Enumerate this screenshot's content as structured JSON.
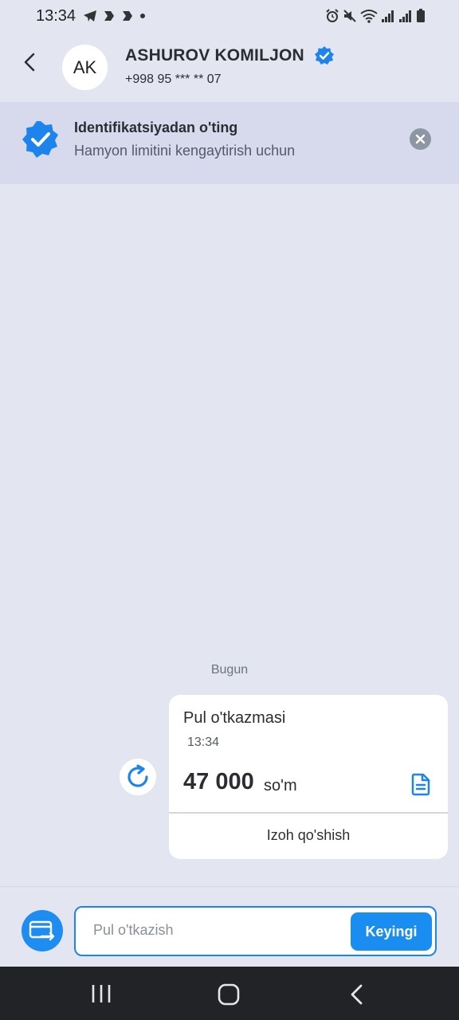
{
  "status_bar": {
    "time": "13:34",
    "left_icons": [
      "telegram-icon",
      "app-icon",
      "app-icon",
      "dot-icon"
    ],
    "right_icons": [
      "alarm-icon",
      "mute-icon",
      "wifi-icon",
      "signal-icon",
      "signal-icon",
      "battery-icon"
    ]
  },
  "header": {
    "avatar_initials": "AK",
    "name": "ASHUROV KOMILJON",
    "phone": "+998 95 *** ** 07",
    "verified": true
  },
  "banner": {
    "title": "Identifikatsiyadan o'ting",
    "subtitle": "Hamyon limitini kengaytirish uchun"
  },
  "chat": {
    "date_label": "Bugun",
    "message": {
      "title": "Pul o'tkazmasi",
      "time": "13:34",
      "amount": "47 000",
      "currency": "so'm",
      "comment_action": "Izoh qo'shish"
    }
  },
  "composer": {
    "input_placeholder": "Pul o'tkazish",
    "input_value": "",
    "next_label": "Keyingi"
  },
  "colors": {
    "accent": "#1d8df1",
    "background": "#e3e6f1",
    "banner_bg": "#d6daec",
    "nav_bar": "#222327"
  }
}
